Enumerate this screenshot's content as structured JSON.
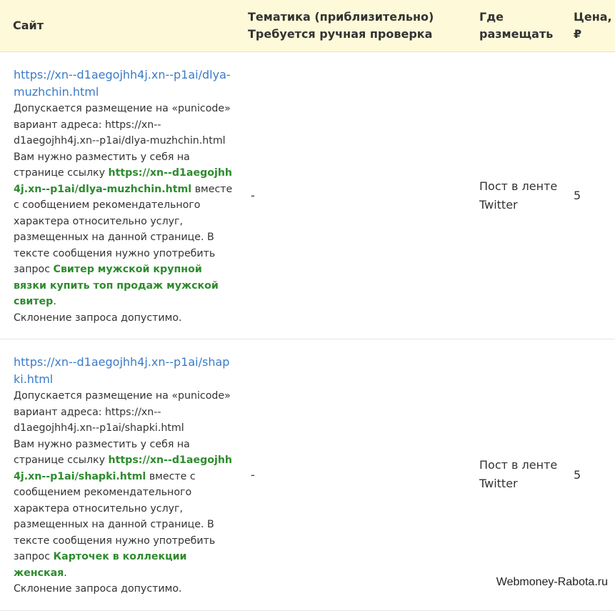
{
  "header": {
    "site": "Сайт",
    "theme_line1": "Тематика (приблизительно)",
    "theme_line2": "Требуется ручная проверка",
    "place_line1": "Где",
    "place_line2": "размещать",
    "price_line1": "Цена,",
    "price_line2": "₽"
  },
  "rows": [
    {
      "url": "https://xn--d1aegojhh4j.xn--p1ai/dlya-muzhchin.html",
      "punicode_text": "Допускается размещение на «punicode» вариант адреса: https://xn--d1aegojhh4j.xn--p1ai/dlya-muzhchin.html",
      "place_intro": "Вам нужно разместить у себя на странице ссылку",
      "link_bold": "https://xn--d1aegojhh4j.xn--p1ai/dlya-muzhchin.html",
      "place_after": "вместе с сообщением рекомендательного характера относительно услуг, размещенных на данной странице. В тексте сообщения нужно употребить запрос",
      "query": "Свитер мужской крупной вязки купить топ продаж мужской свитер",
      "query_end": ".",
      "declension": "Склонение запроса допустимо.",
      "theme": "-",
      "place": "Пост в ленте Twitter",
      "price": "5"
    },
    {
      "url": "https://xn--d1aegojhh4j.xn--p1ai/shapki.html",
      "punicode_text": "Допускается размещение на «punicode» вариант адреса: https://xn--d1aegojhh4j.xn--p1ai/shapki.html",
      "place_intro": "Вам нужно разместить у себя на странице ссылку",
      "link_bold": "https://xn--d1aegojhh4j.xn--p1ai/shapki.html",
      "place_after": "вместе с сообщением рекомендательного характера относительно услуг, размещенных на данной странице. В тексте сообщения нужно употребить запрос",
      "query": "Карточек в коллекции женская",
      "query_end": ".",
      "declension": "Склонение запроса допустимо.",
      "theme": "-",
      "place": "Пост в ленте Twitter",
      "price": "5"
    }
  ],
  "watermark": "Webmoney-Rabota.ru",
  "colors": {
    "header_bg": "#fdf9d9",
    "link": "#3a7bc8",
    "highlight": "#2e8b2e"
  }
}
